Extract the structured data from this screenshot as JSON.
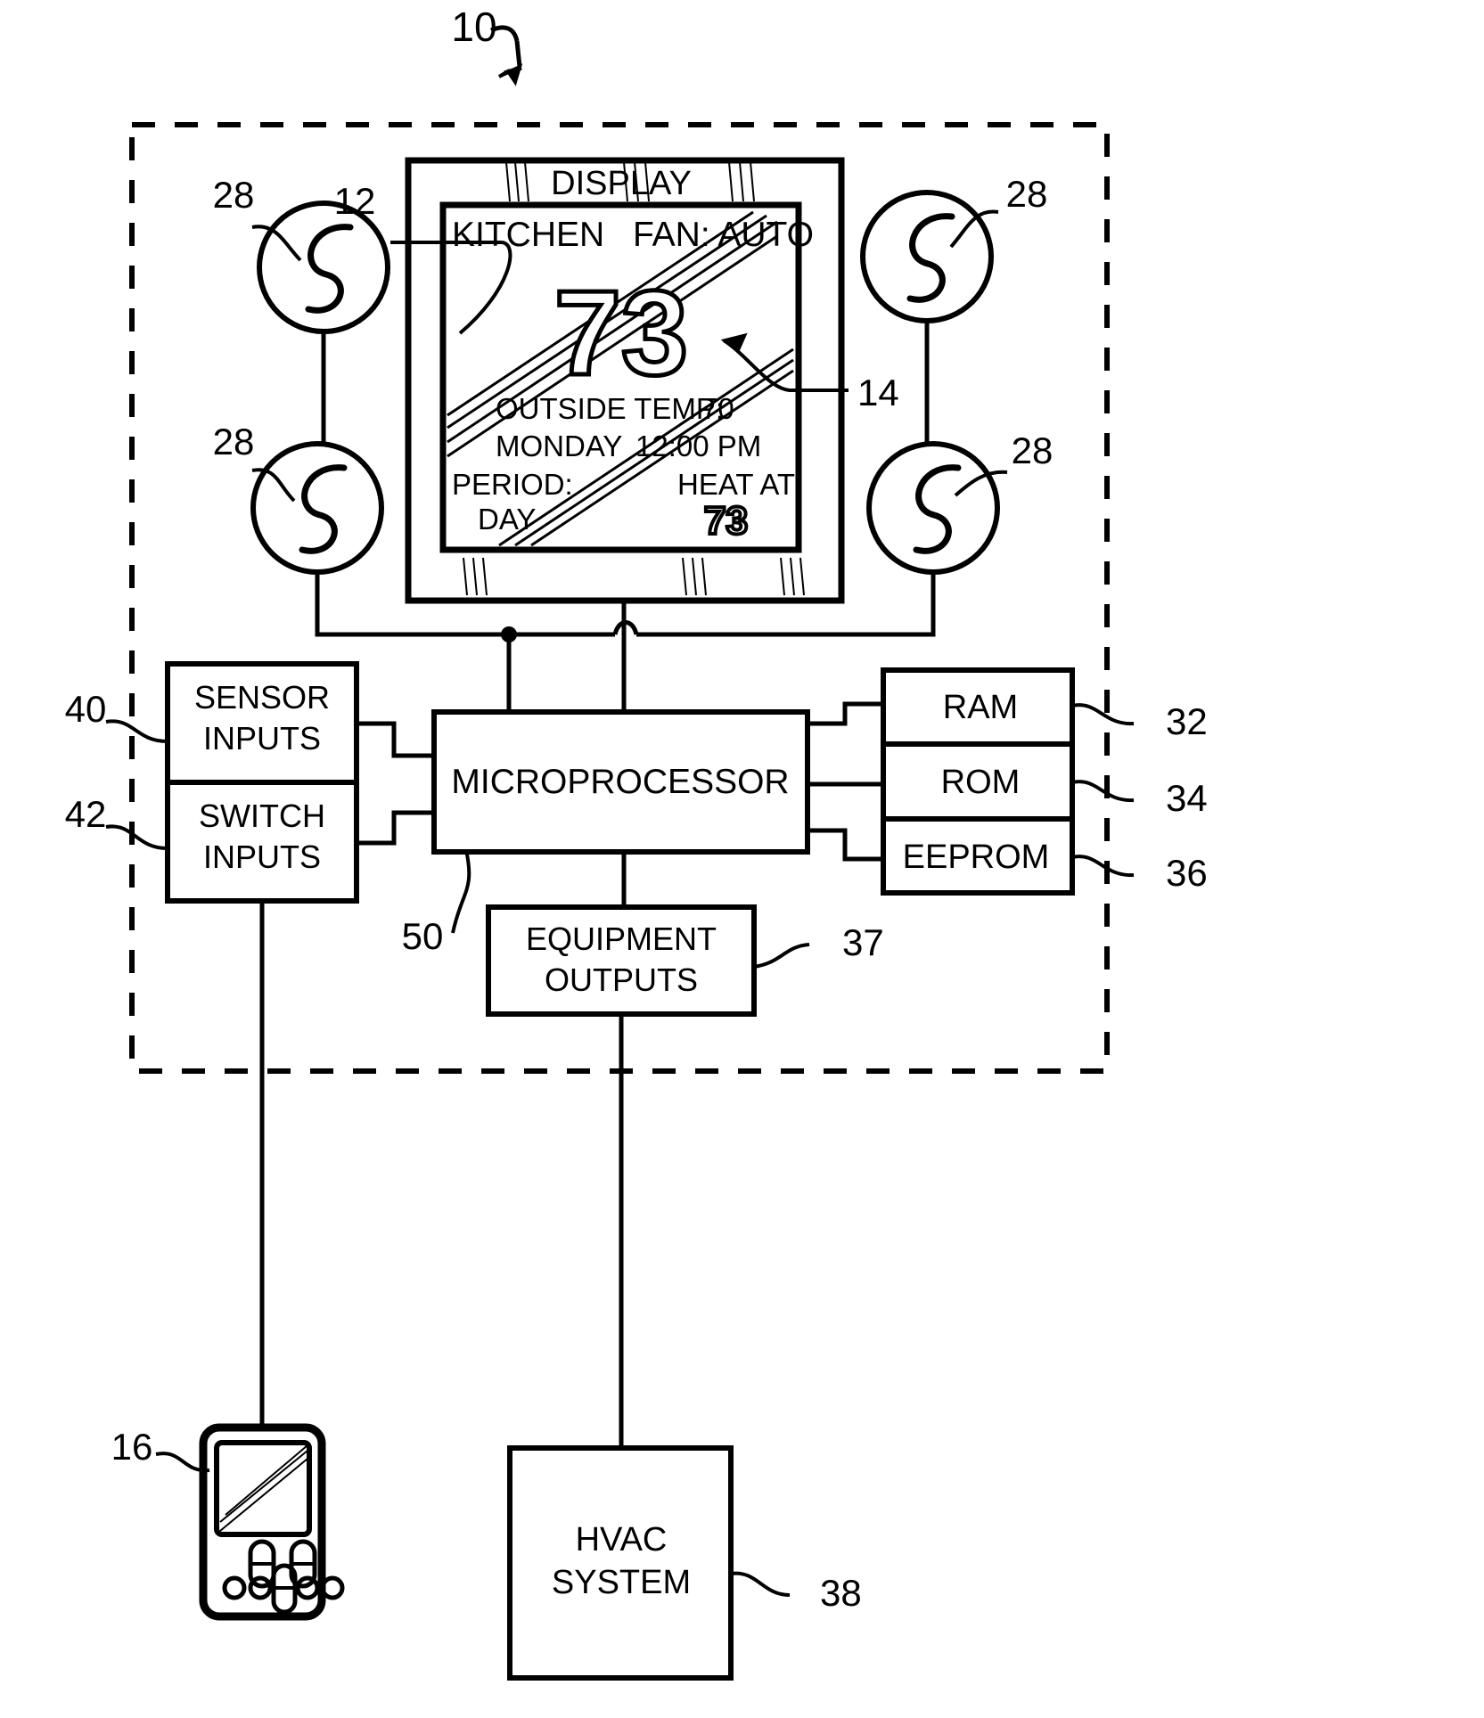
{
  "figure": {
    "reference_number": "10",
    "title_block_label": "DISPLAY"
  },
  "display_unit": {
    "outer_label": "DISPLAY",
    "outer_ref": "",
    "screen_ref": "12",
    "temperature_ref": "14",
    "screen": {
      "zone_name": "KITCHEN",
      "fan_status": "FAN: AUTO",
      "current_temperature": "73",
      "outside_temp_label": "OUTSIDE  TEMP:",
      "outside_temp_value": "70",
      "day": "MONDAY",
      "time": "12:00  PM",
      "period_label": "PERIOD:",
      "period_value": "DAY",
      "setpoint_label": "HEAT  AT",
      "setpoint_value": "73"
    }
  },
  "buttons": {
    "ref": "28",
    "count": 4,
    "refs": [
      "28",
      "28",
      "28",
      "28"
    ]
  },
  "blocks": {
    "sensor_inputs": {
      "label_line1": "SENSOR",
      "label_line2": "INPUTS",
      "ref": "40"
    },
    "switch_inputs": {
      "label_line1": "SWITCH",
      "label_line2": "INPUTS",
      "ref": "42"
    },
    "microprocessor": {
      "label": "MICROPROCESSOR",
      "ref": "50"
    },
    "equipment_outputs": {
      "label_line1": "EQUIPMENT",
      "label_line2": "OUTPUTS",
      "ref": "37"
    },
    "ram": {
      "label": "RAM",
      "ref": "32"
    },
    "rom": {
      "label": "ROM",
      "ref": "34"
    },
    "eeprom": {
      "label": "EEPROM",
      "ref": "36"
    },
    "hvac_system": {
      "label_line1": "HVAC",
      "label_line2": "SYSTEM",
      "ref": "38"
    },
    "handheld_device": {
      "ref": "16"
    }
  },
  "colors": {
    "ink": "#000000",
    "paper": "#ffffff"
  }
}
